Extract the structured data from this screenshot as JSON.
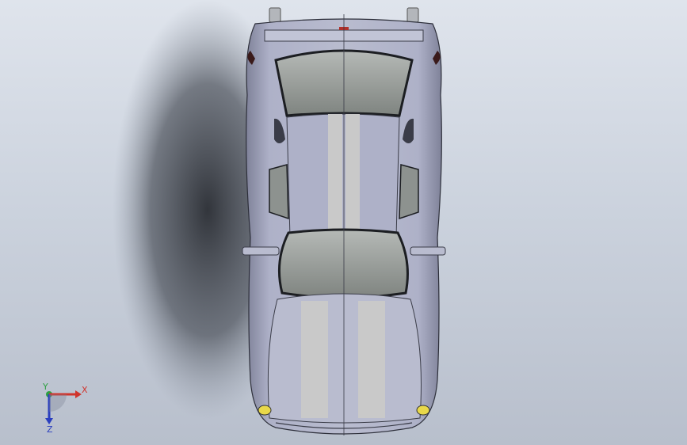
{
  "viewport": {
    "background_top": "#dfe4ec",
    "background_bottom": "#b8bfcc"
  },
  "model": {
    "body_color": "#a9adc4",
    "stripe_color": "#c9c9c9",
    "glass_color": "#8d928f",
    "headlight_color": "#e8d84a"
  },
  "triad": {
    "x_label": "X",
    "y_label": "Y",
    "z_label": "Z",
    "x_color": "#d0342c",
    "y_color": "#2ea043",
    "z_color": "#2b3fbf"
  }
}
